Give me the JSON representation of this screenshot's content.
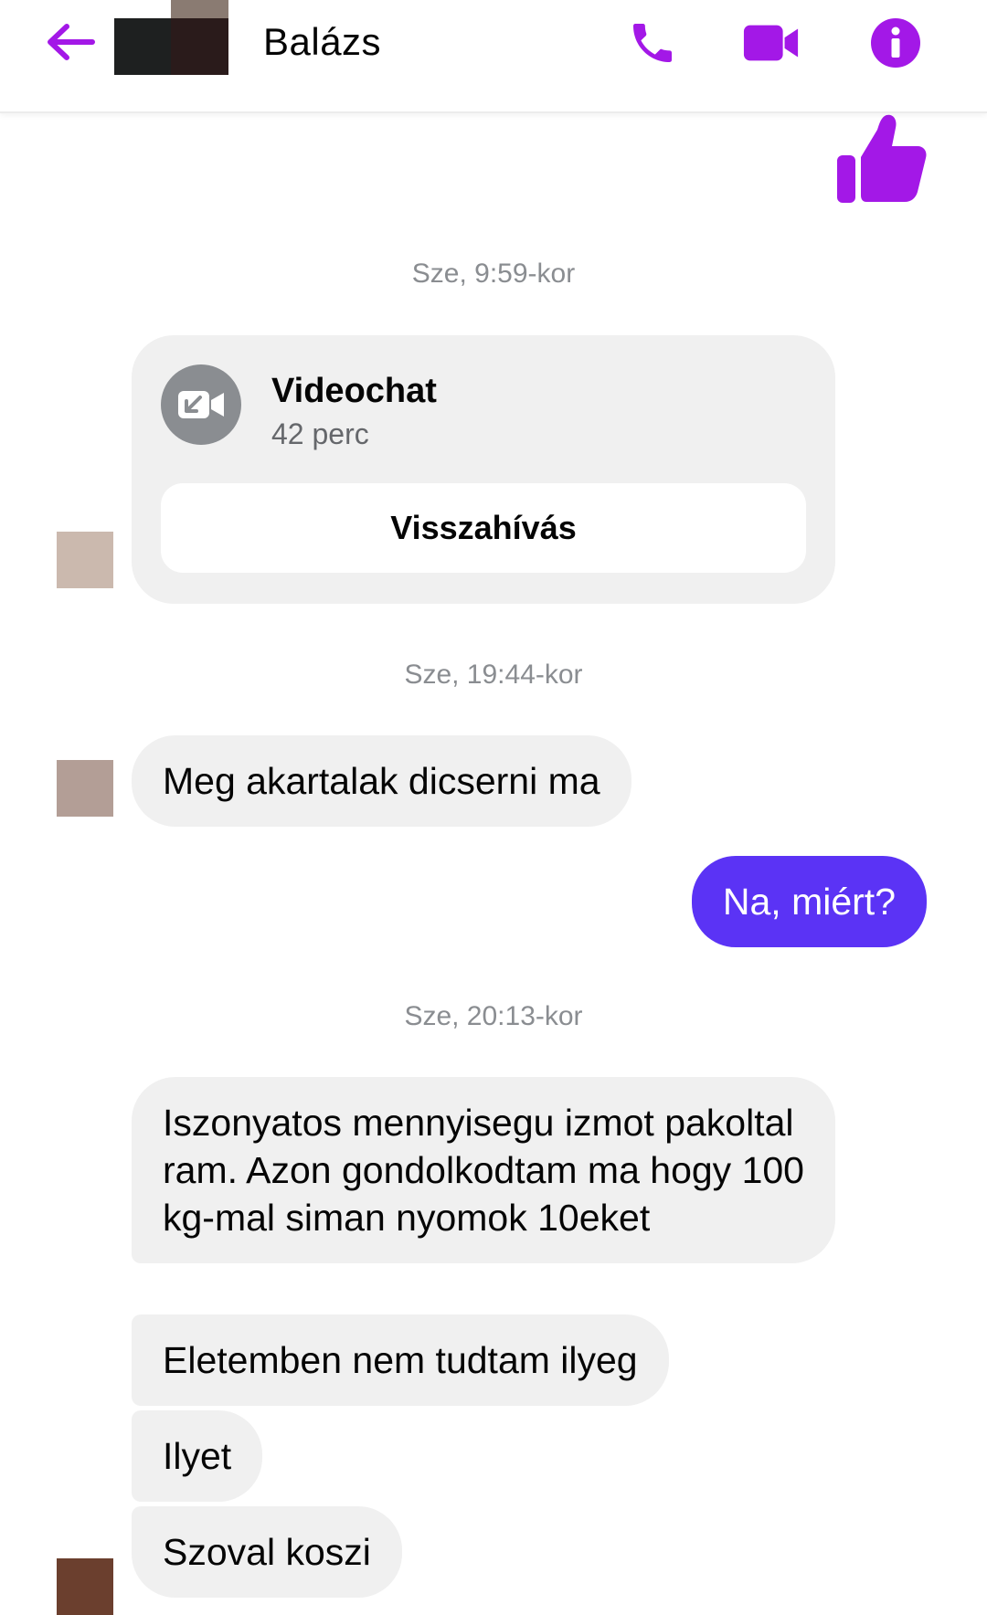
{
  "header": {
    "contact_name": "Balázs",
    "accent_color": "#a318e7",
    "icons": [
      "back-arrow-icon",
      "phone-icon",
      "video-camera-icon",
      "info-icon"
    ]
  },
  "thread": {
    "like_sticker": "thumbs-up-icon",
    "timestamps": [
      "Sze, 9:59-kor",
      "Sze, 19:44-kor",
      "Sze, 20:13-kor"
    ],
    "call": {
      "title": "Videochat",
      "duration": "42 perc",
      "callback_label": "Visszahívás",
      "icon": "missed-video-call-icon"
    },
    "messages": [
      {
        "direction": "incoming",
        "text": "Meg akartalak dicserni ma"
      },
      {
        "direction": "outgoing",
        "text": "Na, miért?"
      },
      {
        "direction": "incoming",
        "text": "Iszonyatos mennyisegu izmot pakoltal ram. Azon gondolkodtam ma hogy 100 kg-mal siman nyomok 10eket"
      },
      {
        "direction": "incoming",
        "text": "Eletemben nem tudtam ilyeg"
      },
      {
        "direction": "incoming",
        "text": "Ilyet"
      },
      {
        "direction": "incoming",
        "text": "Szoval koszi"
      }
    ],
    "outgoing_color": "#5b33f5",
    "incoming_color": "#f0f0f0"
  }
}
